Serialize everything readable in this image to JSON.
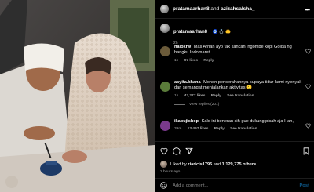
{
  "header": {
    "user1": "pratamaarhan8",
    "connector": "and",
    "user2": "azizahsalsha_"
  },
  "caption": {
    "username": "pratamaarhan8",
    "emoji": "🧿 💍 🤲",
    "time": "2h"
  },
  "comments": [
    {
      "username": "halokrw",
      "text": "Mas Arhan ayo tak kancani ngombe kopi Golda ng bangku Indomaret",
      "time": "1h",
      "likes": "97 likes",
      "reply_label": "Reply",
      "avatar_color": "#6b5b3a"
    },
    {
      "username": "asyifa.khana",
      "text": "Mohon pencerahannya supaya tidur kami nyenyak dan semangat menjalankan aktivitas 🙂",
      "time": "1h",
      "likes": "43,277 likes",
      "reply_label": "Reply",
      "translation_label": "See translation",
      "view_replies": "View replies (201)",
      "avatar_color": "#5a7b3a"
    },
    {
      "username": "ikapujishop",
      "text": "Kalo ini beneran sih gue dukung pisah aja Han,",
      "time": "39m",
      "likes": "13,497 likes",
      "reply_label": "Reply",
      "translation_label": "See translation",
      "avatar_color": "#7a3a8c"
    }
  ],
  "actions": {
    "icons": [
      "heart-icon",
      "comment-icon",
      "share-icon",
      "bookmark-icon"
    ],
    "liked_by_prefix": "Liked by",
    "liked_by_user": "riaricis1795",
    "liked_by_and": "and",
    "liked_by_count": "1,129,775 others",
    "posted_ago": "2 hours ago"
  },
  "comment_box": {
    "placeholder": "Add a comment...",
    "post_label": "Post"
  },
  "colors": {
    "background": "#000000",
    "muted_text": "#a8a8a8",
    "post_link": "#0e5a8c"
  }
}
